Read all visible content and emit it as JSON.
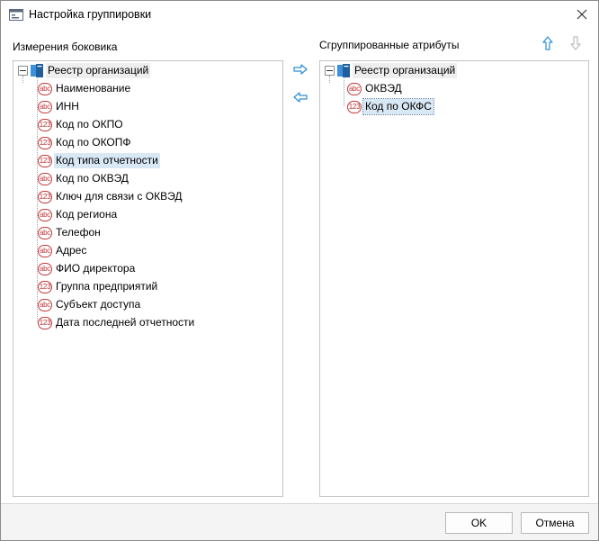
{
  "window": {
    "title": "Настройка группировки"
  },
  "left": {
    "label": "Измерения боковика",
    "root": "Реестр организаций",
    "items": [
      {
        "label": "Наименование",
        "type": "abc"
      },
      {
        "label": "ИНН",
        "type": "abc"
      },
      {
        "label": "Код по ОКПО",
        "type": "123"
      },
      {
        "label": "Код по ОКОПФ",
        "type": "123"
      },
      {
        "label": "Код типа отчетности",
        "type": "123"
      },
      {
        "label": "Код по ОКВЭД",
        "type": "abc"
      },
      {
        "label": "Ключ для связи с ОКВЭД",
        "type": "123"
      },
      {
        "label": "Код региона",
        "type": "abc"
      },
      {
        "label": "Телефон",
        "type": "abc"
      },
      {
        "label": "Адрес",
        "type": "abc"
      },
      {
        "label": "ФИО директора",
        "type": "abc"
      },
      {
        "label": "Группа предприятий",
        "type": "123"
      },
      {
        "label": "Субъект доступа",
        "type": "abc"
      },
      {
        "label": "Дата последней отчетности",
        "type": "123"
      }
    ]
  },
  "right": {
    "label": "Сгруппированные атрибуты",
    "root": "Реестр организаций",
    "items": [
      {
        "label": "ОКВЭД",
        "type": "abc"
      },
      {
        "label": "Код по ОКФС",
        "type": "123"
      }
    ]
  },
  "footer": {
    "ok_label": "OK",
    "cancel_label": "Отмена"
  },
  "colors": {
    "accent_arrow": "#2a8fd6",
    "disabled_arrow": "#bcbcbc",
    "selection": "#d9e8f5"
  }
}
